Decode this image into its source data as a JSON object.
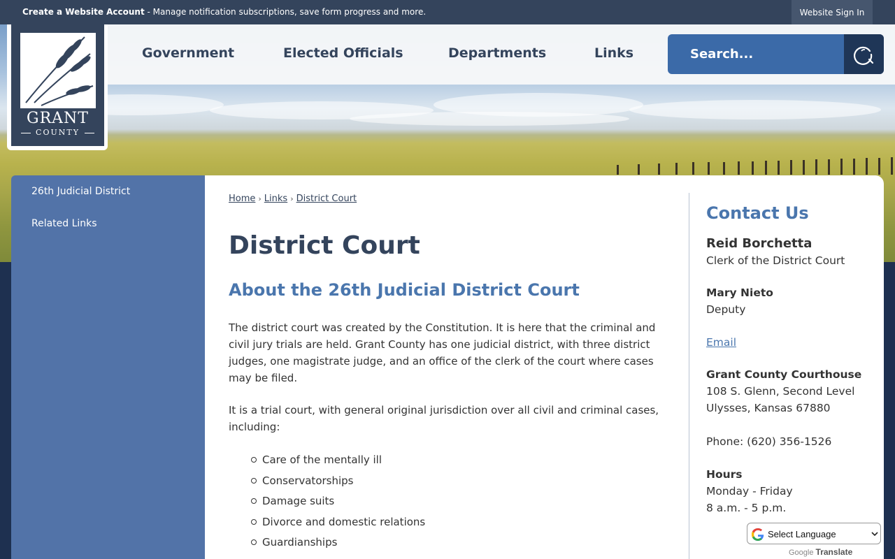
{
  "top_bar": {
    "account_link": "Create a Website Account",
    "account_desc": " - Manage notification subscriptions, save form progress and more.",
    "sign_in": "Website Sign In"
  },
  "logo": {
    "name": "GRANT",
    "subname": "COUNTY"
  },
  "nav": {
    "items": [
      "Government",
      "Elected Officials",
      "Departments",
      "Links"
    ]
  },
  "search": {
    "placeholder": "Search..."
  },
  "sidebar": {
    "items": [
      "26th Judicial District",
      "Related Links"
    ]
  },
  "breadcrumb": [
    "Home",
    "Links",
    "District Court"
  ],
  "main": {
    "title": "District Court",
    "subtitle": "About the 26th Judicial District Court",
    "paragraphs": [
      "The district court was created by the Constitution. It is here that the criminal and civil jury trials are held. Grant County has one judicial district, with three district judges, one magistrate judge, and an office of the clerk of the court where cases may be filed.",
      "It is a trial court, with general original jurisdiction over all civil and criminal cases, including:"
    ],
    "list": [
      "Care of the mentally ill",
      "Conservatorships",
      "Damage suits",
      "Divorce and domestic relations",
      "Guardianships"
    ]
  },
  "contact": {
    "title": "Contact Us",
    "person1_name": "Reid Borchetta",
    "person1_title": "Clerk of the District Court",
    "person2_name": "Mary Nieto",
    "person2_title": "Deputy",
    "email_label": "Email",
    "location_name": "Grant County Courthouse",
    "address_line1": "108 S. Glenn, Second Level",
    "address_line2": "Ulysses, Kansas 67880",
    "phone": "Phone: (620) 356-1526",
    "hours_label": "Hours",
    "hours_days": "Monday - Friday",
    "hours_time": "8 a.m. - 5 p.m."
  },
  "translate": {
    "select_label": "Select Language",
    "powered_by": "Google",
    "translate_word": "Translate"
  },
  "colors": {
    "navy": "#34445c",
    "accent_blue": "#4a76ad",
    "sidebar_blue": "#5273a8",
    "search_blue": "#3b6aa8"
  }
}
